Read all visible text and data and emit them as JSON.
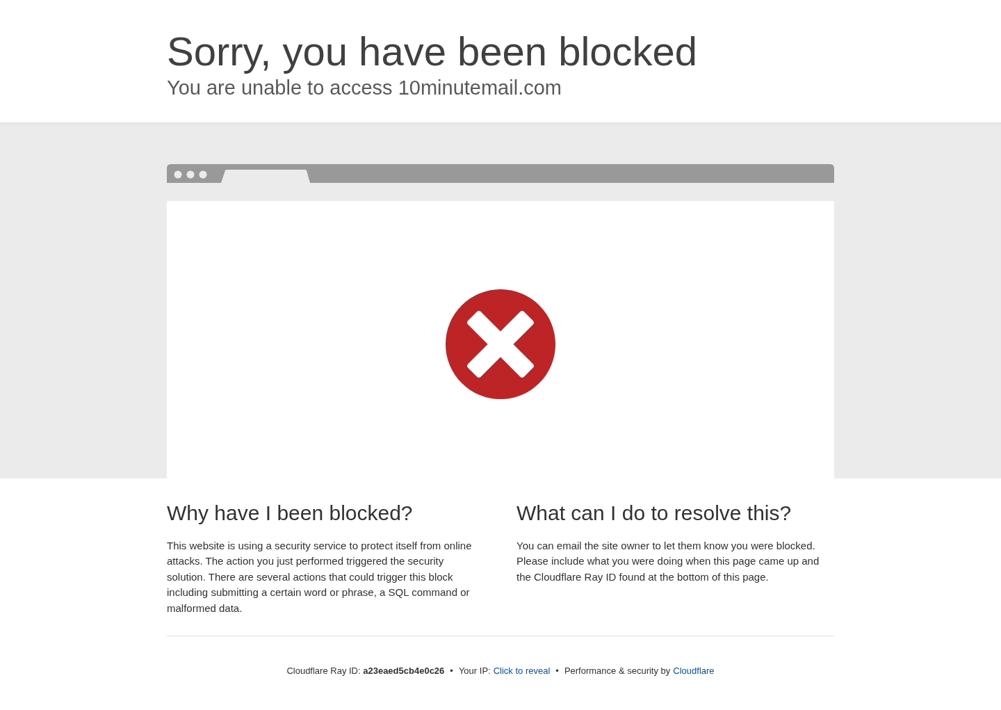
{
  "header": {
    "title": "Sorry, you have been blocked",
    "subtitle": "You are unable to access 10minutemail.com"
  },
  "sections": [
    {
      "heading": "Why have I been blocked?",
      "text": "This website is using a security service to protect itself from online attacks. The action you just performed triggered the security solution. There are several actions that could trigger this block including submitting a certain word or phrase, a SQL command or malformed data."
    },
    {
      "heading": "What can I do to resolve this?",
      "text": "You can email the site owner to let them know you were blocked. Please include what you were doing when this page came up and the Cloudflare Ray ID found at the bottom of this page."
    }
  ],
  "footer": {
    "items": [
      {
        "kind": "text",
        "text": "Cloudflare Ray ID: **a23eaed5cb4e0c26**"
      },
      {
        "kind": "separator",
        "text": "•"
      },
      {
        "kind": "text",
        "text": "Your IP:"
      },
      {
        "kind": "link",
        "text": "Click to reveal"
      },
      {
        "kind": "separator",
        "text": "•"
      },
      {
        "kind": "text",
        "text": "Performance & security by"
      },
      {
        "kind": "link",
        "text": "Cloudflare"
      }
    ]
  }
}
